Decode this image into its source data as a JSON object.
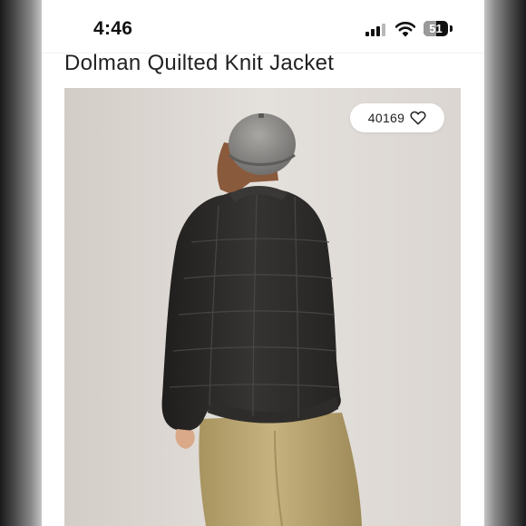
{
  "status_bar": {
    "time": "4:46",
    "battery_percent": "51",
    "battery_level": 0.51,
    "icons": [
      "cellular-signal-icon",
      "wifi-icon",
      "battery-icon"
    ]
  },
  "product": {
    "title": "Dolman Quilted Knit Jacket",
    "likes": "40169",
    "like_icon": "heart-outline-icon",
    "image_alt": "Model wearing a black quilted jacket, grey beret and khaki trousers, seen from behind"
  },
  "colors": {
    "background": "#ffffff",
    "photo_backdrop": "#d9d4cf",
    "jacket": "#2b2a29",
    "trousers": "#bda977"
  }
}
